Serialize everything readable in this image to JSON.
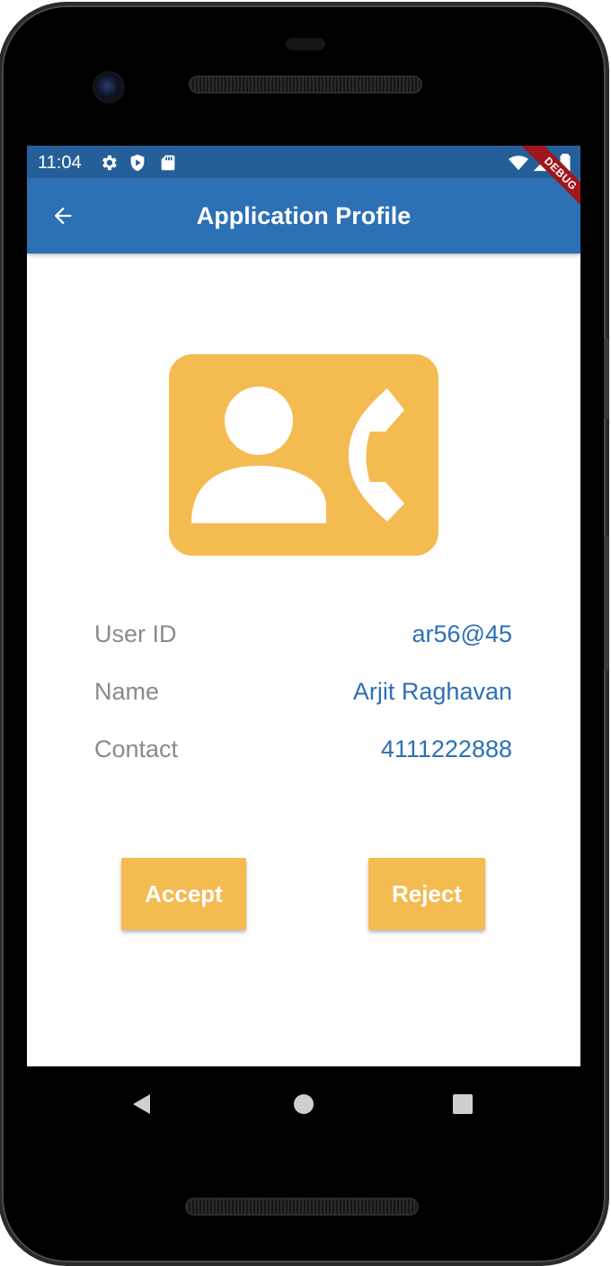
{
  "status_bar": {
    "time": "11:04",
    "icons": [
      "gear-icon",
      "shield-play-icon",
      "sd-card-icon",
      "wifi-icon",
      "signal-icon",
      "battery-icon"
    ]
  },
  "app_bar": {
    "title": "Application Profile",
    "back_icon": "arrow-back-icon"
  },
  "debug_banner": "DEBUG",
  "profile": {
    "icon": "contact-phone-icon",
    "rows": [
      {
        "label": "User ID",
        "value": "ar56@45"
      },
      {
        "label": "Name",
        "value": "Arjit Raghavan"
      },
      {
        "label": "Contact",
        "value": "4111222888"
      }
    ]
  },
  "actions": {
    "accept_label": "Accept",
    "reject_label": "Reject"
  },
  "nav_bar": {
    "icons": [
      "back-triangle-icon",
      "home-circle-icon",
      "recents-square-icon"
    ]
  },
  "colors": {
    "status_bar": "#255f9a",
    "app_bar": "#2c70b6",
    "accent": "#f4bb51",
    "value_text": "#2c70b6",
    "label_text": "#8a8a8a",
    "debug_ribbon": "#a0161a"
  }
}
